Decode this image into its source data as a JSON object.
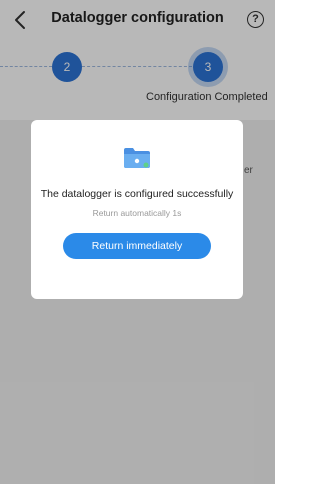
{
  "header": {
    "title": "Datalogger configuration",
    "help_label": "?",
    "back_icon": "chevron-left-icon"
  },
  "steps": {
    "step2_number": "2",
    "step3_number": "3",
    "step3_label": "Configuration Completed"
  },
  "background": {
    "partial_text": "er"
  },
  "dialog": {
    "icon": "folder-icon",
    "message": "The datalogger is configured successfully",
    "countdown": "Return automatically 1s",
    "button_label": "Return immediately"
  },
  "colors": {
    "accent": "#2b73d6",
    "button": "#2b8ae8"
  }
}
